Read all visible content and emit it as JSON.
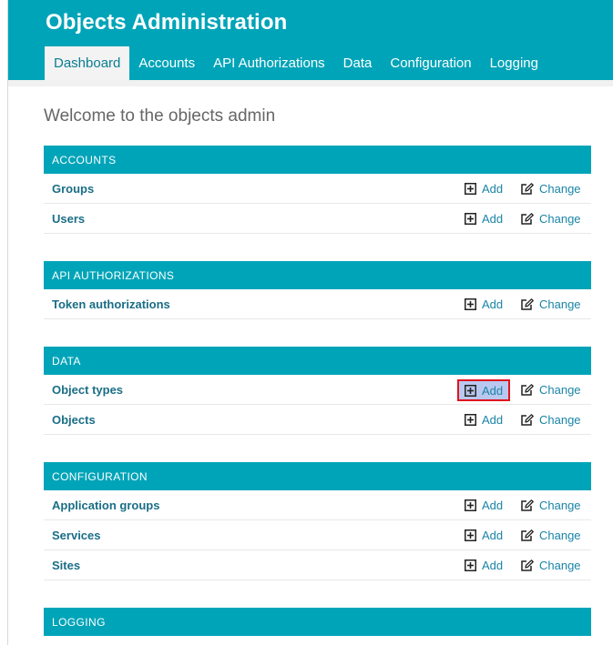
{
  "header": {
    "title": "Objects Administration",
    "nav": [
      {
        "label": "Dashboard",
        "active": true
      },
      {
        "label": "Accounts"
      },
      {
        "label": "API Authorizations"
      },
      {
        "label": "Data"
      },
      {
        "label": "Configuration"
      },
      {
        "label": "Logging"
      }
    ]
  },
  "welcome": "Welcome to the objects admin",
  "actions": {
    "add": "Add",
    "change": "Change"
  },
  "modules": [
    {
      "title": "ACCOUNTS",
      "rows": [
        "Groups",
        "Users"
      ]
    },
    {
      "title": "API AUTHORIZATIONS",
      "rows": [
        "Token authorizations"
      ]
    },
    {
      "title": "DATA",
      "rows": [
        "Object types",
        "Objects"
      ]
    },
    {
      "title": "CONFIGURATION",
      "rows": [
        "Application groups",
        "Services",
        "Sites"
      ]
    },
    {
      "title": "LOGGING",
      "rows": []
    }
  ],
  "colors": {
    "accent": "#00a4b8",
    "link": "#1a84a6",
    "highlight_border": "#e0151f",
    "highlight_fill": "#b9c8ef"
  },
  "highlighted_action": {
    "module": "DATA",
    "row": "Object types",
    "action": "Add"
  }
}
